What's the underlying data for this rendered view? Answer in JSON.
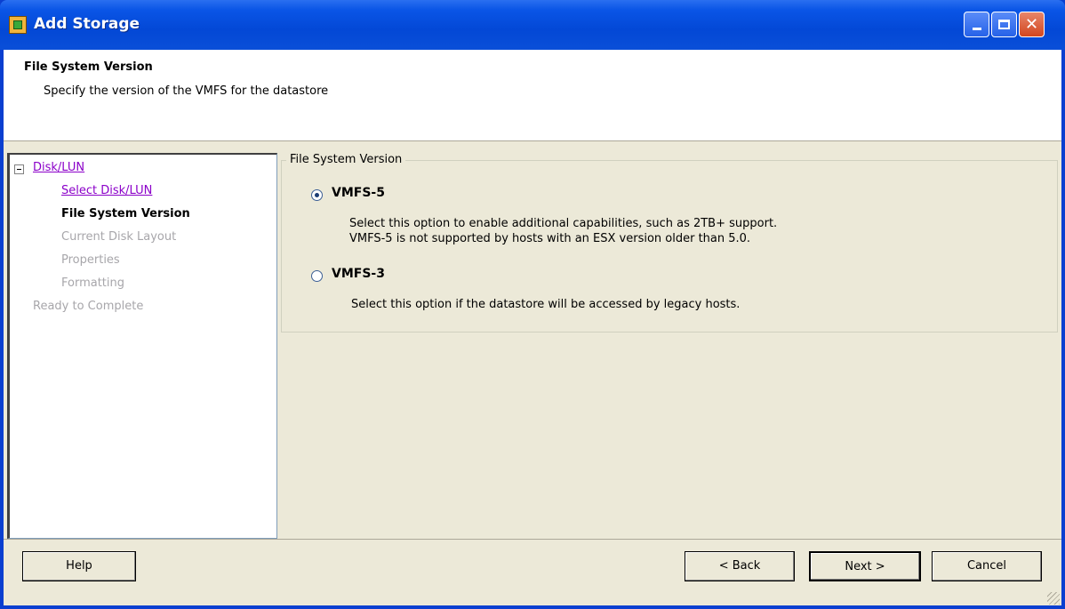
{
  "window": {
    "title": "Add Storage",
    "controls": {
      "minimize": "",
      "maximize": "",
      "close": "✕"
    }
  },
  "header": {
    "title": "File System Version",
    "description": "Specify the version of the VMFS for the datastore"
  },
  "nav": {
    "collapse_glyph": "",
    "items": [
      {
        "label": "Disk/LUN",
        "state": "link"
      },
      {
        "label": "Select Disk/LUN",
        "state": "link"
      },
      {
        "label": "File System Version",
        "state": "current"
      },
      {
        "label": "Current Disk Layout",
        "state": "disabled"
      },
      {
        "label": "Properties",
        "state": "disabled"
      },
      {
        "label": "Formatting",
        "state": "disabled"
      },
      {
        "label": "Ready to Complete",
        "state": "disabled"
      }
    ]
  },
  "content": {
    "group_label": "File System Version",
    "options": [
      {
        "label": "VMFS-5",
        "selected": true,
        "description_lines": [
          "Select this option to enable additional capabilities, such as 2TB+ support.",
          "VMFS-5 is not supported by hosts with an ESX version older than 5.0."
        ]
      },
      {
        "label": "VMFS-3",
        "selected": false,
        "description_lines": [
          "Select this option if the datastore will be accessed by legacy hosts."
        ]
      }
    ]
  },
  "footer": {
    "help": "Help",
    "back": "< Back",
    "next": "Next >",
    "cancel": "Cancel"
  },
  "colors": {
    "titlebar": "#0a55e6",
    "dialog_bg": "#ece9d8",
    "link": "#8b00c9",
    "disabled_text": "#a7a6aa"
  }
}
